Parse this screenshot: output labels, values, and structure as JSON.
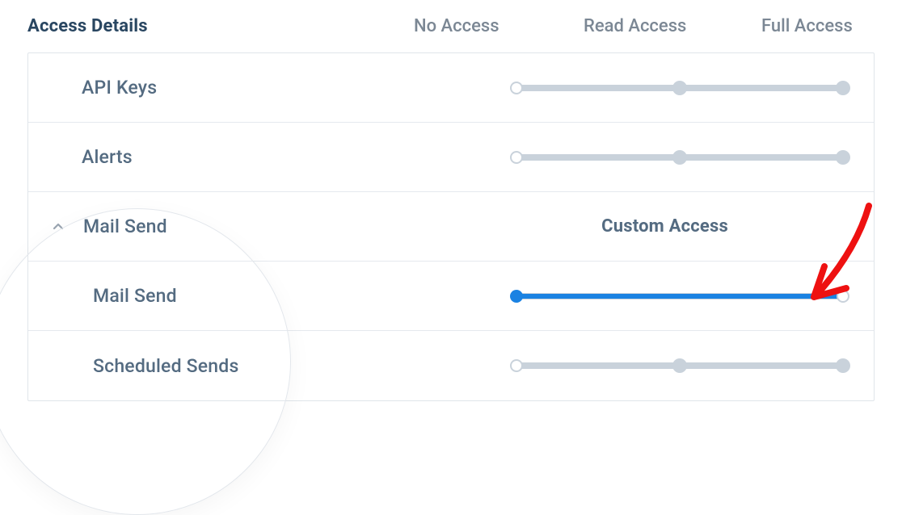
{
  "title": "Access Details",
  "columns": {
    "none": "No Access",
    "read": "Read Access",
    "full": "Full Access"
  },
  "rows": {
    "api_keys": {
      "label": "API Keys",
      "level": "none"
    },
    "alerts": {
      "label": "Alerts",
      "level": "none"
    },
    "mail_send_group": {
      "label": "Mail Send",
      "expanded": true,
      "status": "Custom Access"
    },
    "mail_send": {
      "label": "Mail Send",
      "two_stop": true,
      "level": "none"
    },
    "scheduled_sends": {
      "label": "Scheduled Sends",
      "level": "none"
    }
  }
}
